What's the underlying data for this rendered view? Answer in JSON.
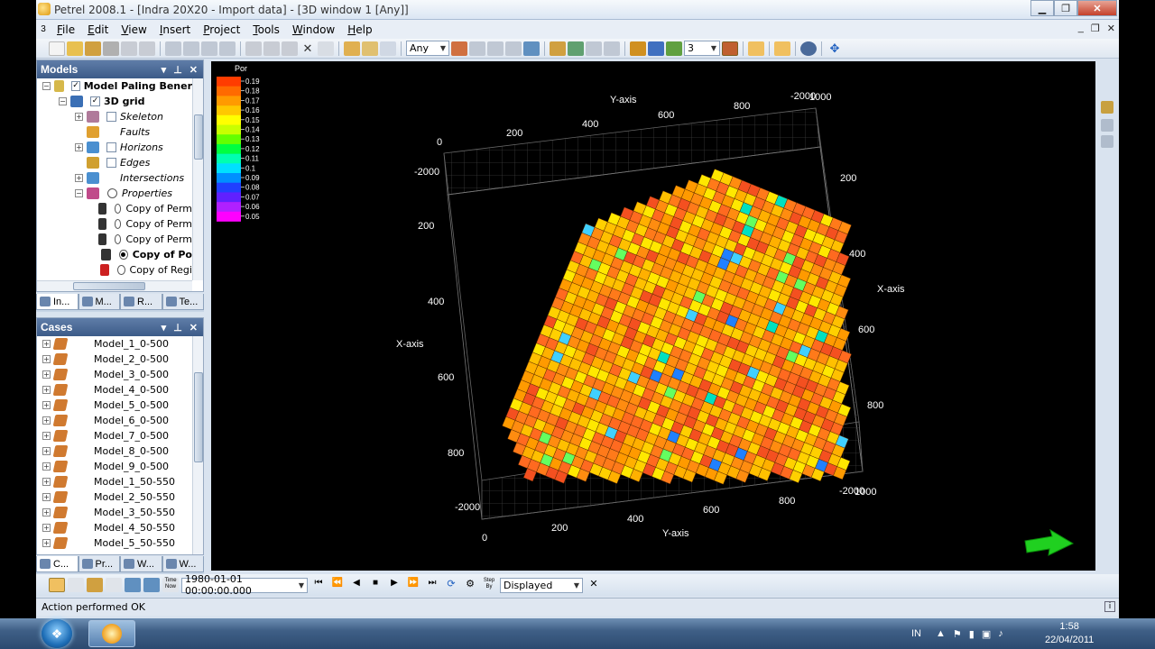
{
  "window": {
    "title": "Petrel 2008.1 - [Indra 20X20 - Import data] - [3D window 1 [Any]]"
  },
  "menu": [
    "File",
    "Edit",
    "View",
    "Insert",
    "Project",
    "Tools",
    "Window",
    "Help"
  ],
  "toolbar": {
    "filter_value": "Any",
    "count_value": "3"
  },
  "models_panel": {
    "title": "Models",
    "items": [
      {
        "label": "Model Paling Bener",
        "level": 0,
        "bold": true,
        "italic": false,
        "exp": "−",
        "check": true,
        "color": "#d6b84a"
      },
      {
        "label": "3D grid",
        "level": 1,
        "bold": true,
        "italic": false,
        "exp": "−",
        "check": true,
        "color": "#3a6fb5"
      },
      {
        "label": "Skeleton",
        "level": 2,
        "bold": false,
        "italic": true,
        "exp": "+",
        "check": "empty",
        "color": "#b07a9a"
      },
      {
        "label": "Faults",
        "level": 2,
        "bold": false,
        "italic": true,
        "exp": "",
        "check": "none",
        "color": "#e0a030"
      },
      {
        "label": "Horizons",
        "level": 2,
        "bold": false,
        "italic": true,
        "exp": "+",
        "check": "empty",
        "color": "#4a8fd0"
      },
      {
        "label": "Edges",
        "level": 2,
        "bold": false,
        "italic": true,
        "exp": "",
        "check": "empty",
        "color": "#d0a030"
      },
      {
        "label": "Intersections",
        "level": 2,
        "bold": false,
        "italic": true,
        "exp": "+",
        "check": "none",
        "color": "#4a8fd0"
      },
      {
        "label": "Properties",
        "level": 2,
        "bold": false,
        "italic": true,
        "exp": "−",
        "check": "radio",
        "color": "#c04a8a"
      },
      {
        "label": "Copy of Perm",
        "level": 3,
        "bold": false,
        "italic": false,
        "exp": "",
        "check": "radio",
        "color": "#333333"
      },
      {
        "label": "Copy of Perm",
        "level": 3,
        "bold": false,
        "italic": false,
        "exp": "",
        "check": "radio",
        "color": "#333333"
      },
      {
        "label": "Copy of Perm",
        "level": 3,
        "bold": false,
        "italic": false,
        "exp": "",
        "check": "radio",
        "color": "#333333"
      },
      {
        "label": "Copy of Po",
        "level": 3,
        "bold": true,
        "italic": false,
        "exp": "",
        "check": "radio-on",
        "color": "#333333"
      },
      {
        "label": "Copy of Regi",
        "level": 3,
        "bold": false,
        "italic": false,
        "exp": "",
        "check": "radio",
        "color": "#cc2020"
      }
    ],
    "tabs": [
      "In...",
      "M...",
      "R...",
      "Te..."
    ]
  },
  "cases_panel": {
    "title": "Cases",
    "items": [
      "Model_1_0-500",
      "Model_2_0-500",
      "Model_3_0-500",
      "Model_4_0-500",
      "Model_5_0-500",
      "Model_6_0-500",
      "Model_7_0-500",
      "Model_8_0-500",
      "Model_9_0-500",
      "Model_1_50-550",
      "Model_2_50-550",
      "Model_3_50-550",
      "Model_4_50-550",
      "Model_5_50-550"
    ],
    "tabs": [
      "C...",
      "Pr...",
      "W...",
      "W..."
    ]
  },
  "viewport": {
    "legend_title": "Por",
    "legend_values": [
      "0.19",
      "0.18",
      "0.17",
      "0.16",
      "0.15",
      "0.14",
      "0.13",
      "0.12",
      "0.11",
      "0.1",
      "0.09",
      "0.08",
      "0.07",
      "0.06",
      "0.05"
    ],
    "legend_colors": [
      "#ff3c00",
      "#ff6a00",
      "#ff9a00",
      "#ffc800",
      "#ffff00",
      "#c8ff00",
      "#64ff00",
      "#00ff40",
      "#00ffb0",
      "#00e0ff",
      "#0090ff",
      "#2040ff",
      "#6020ff",
      "#b020ff",
      "#ff00ff"
    ],
    "top_y_axis": {
      "label": "Y-axis",
      "ticks": [
        "200",
        "400",
        "600",
        "800",
        "1000"
      ],
      "left_end": "0",
      "right_end": "-2000"
    },
    "right_x_axis": {
      "label": "X-axis",
      "ticks": [
        "200",
        "400",
        "600",
        "800"
      ],
      "top_end": "-2000"
    },
    "left_x_axis": {
      "label": "X-axis",
      "ticks": [
        "200",
        "400",
        "600",
        "800"
      ]
    },
    "bottom_y_axis": {
      "label": "Y-axis",
      "ticks": [
        "200",
        "400",
        "600",
        "800",
        "1000"
      ],
      "left_end": "-2000",
      "right_end": "-2000",
      "origin": "0"
    },
    "cell_colors": [
      "#ff7a1a",
      "#ff8c10",
      "#ff9a00",
      "#ffb000",
      "#ffd000",
      "#ffe800",
      "#ff6a20",
      "#f45020",
      "#ffc000"
    ],
    "rare_colors": [
      "#64ff60",
      "#00e0c0",
      "#2080ff",
      "#40d0ff"
    ]
  },
  "timebar": {
    "datetime": "1980-01-01 00:00:00.000",
    "mode": "Displayed"
  },
  "status": {
    "text": "Action performed OK"
  },
  "taskbar": {
    "lang": "IN",
    "time": "1:58",
    "date": "22/04/2011"
  }
}
